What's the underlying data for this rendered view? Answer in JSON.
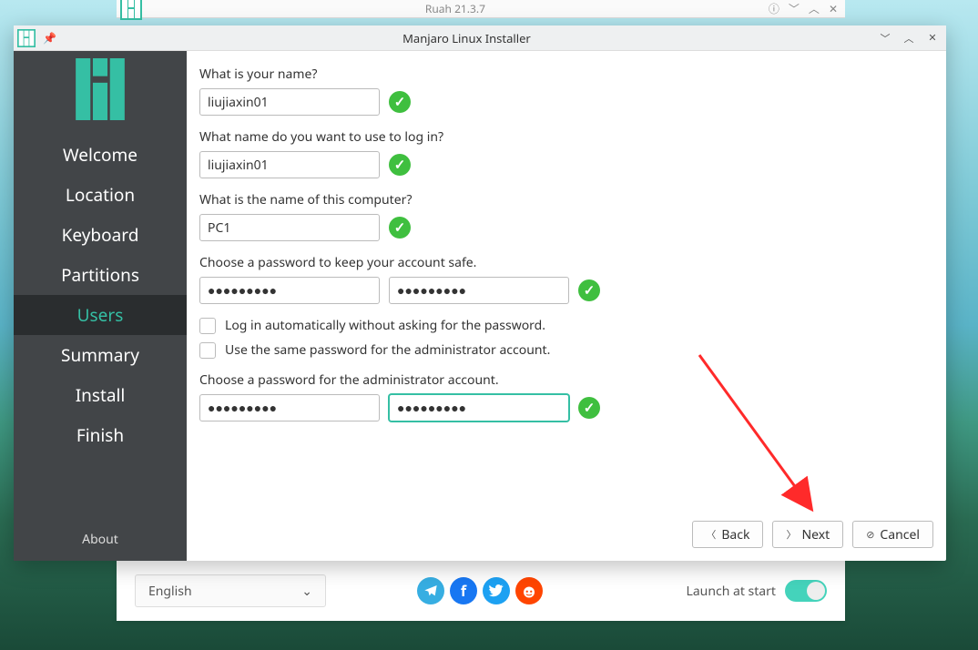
{
  "bg_window": {
    "subtitle": "Ruah 21.3.7",
    "language": "English",
    "launch_label": "Launch at start"
  },
  "installer": {
    "title": "Manjaro Linux Installer",
    "sidebar": {
      "items": [
        {
          "label": "Welcome"
        },
        {
          "label": "Location"
        },
        {
          "label": "Keyboard"
        },
        {
          "label": "Partitions"
        },
        {
          "label": "Users"
        },
        {
          "label": "Summary"
        },
        {
          "label": "Install"
        },
        {
          "label": "Finish"
        }
      ],
      "active_index": 4,
      "about": "About"
    },
    "form": {
      "name_label": "What is your name?",
      "name_value": "liujiaxin01",
      "login_label": "What name do you want to use to log in?",
      "login_value": "liujiaxin01",
      "host_label": "What is the name of this computer?",
      "host_value": "PC1",
      "pwd_label": "Choose a password to keep your account safe.",
      "pwd_value": "●●●●●●●●●",
      "pwd_confirm_value": "●●●●●●●●●",
      "auto_login_label": "Log in automatically without asking for the password.",
      "same_pwd_label": "Use the same password for the administrator account.",
      "admin_pwd_label": "Choose a password for the administrator account.",
      "admin_pwd_value": "●●●●●●●●●",
      "admin_pwd_confirm_value": "●●●●●●●●●"
    },
    "buttons": {
      "back": "Back",
      "next": "Next",
      "cancel": "Cancel"
    }
  }
}
